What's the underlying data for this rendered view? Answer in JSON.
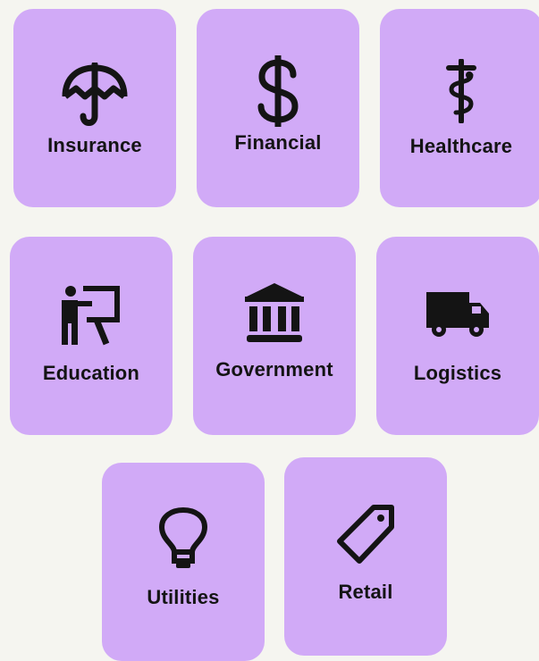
{
  "industries": [
    {
      "label": "Insurance",
      "icon": "umbrella-icon"
    },
    {
      "label": "Financial",
      "icon": "dollar-sign-icon"
    },
    {
      "label": "Healthcare",
      "icon": "caduceus-icon"
    },
    {
      "label": "Education",
      "icon": "teacher-board-icon"
    },
    {
      "label": "Government",
      "icon": "government-building-icon"
    },
    {
      "label": "Logistics",
      "icon": "delivery-truck-icon"
    },
    {
      "label": "Utilities",
      "icon": "lightbulb-icon"
    },
    {
      "label": "Retail",
      "icon": "price-tag-icon"
    }
  ],
  "colors": {
    "background": "#f5f5f0",
    "card": "#d1aaf7",
    "text": "#141414"
  }
}
